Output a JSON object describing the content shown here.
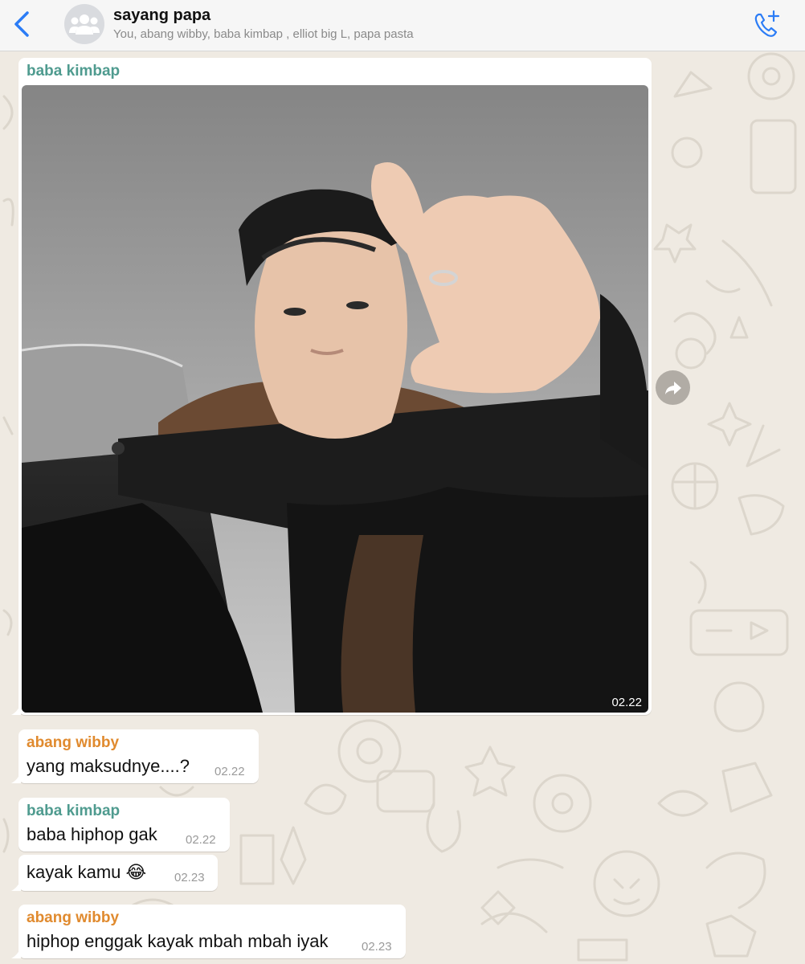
{
  "header": {
    "title": "sayang papa",
    "members": "You, abang wibby, baba kimbap , elliot big L, papa pasta",
    "back_icon": "chevron-left-icon",
    "avatar_icon": "group-icon",
    "call_icon": "add-call-icon"
  },
  "colors": {
    "accent": "#2b7cf6",
    "chat_bg": "#efeae2",
    "sender_teal": "#4f9b8f",
    "sender_orange": "#e08a2e"
  },
  "messages": [
    {
      "sender": "baba kimbap",
      "type": "image",
      "time": "02.22"
    },
    {
      "sender": "abang wibby",
      "text": "yang maksudnye....?",
      "time": "02.22"
    },
    {
      "sender": "baba kimbap",
      "text": "baba hiphop gak",
      "time": "02.22"
    },
    {
      "text": "kayak kamu 😂",
      "time": "02.23"
    },
    {
      "sender": "abang wibby",
      "text": "hiphop enggak kayak mbah mbah iyak",
      "time": "02.23"
    }
  ],
  "forward_icon": "forward-icon"
}
